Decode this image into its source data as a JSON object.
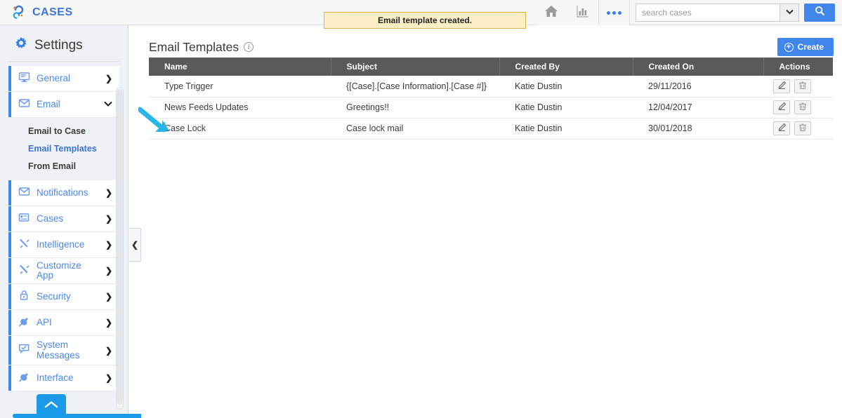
{
  "header": {
    "brand_name": "CASES",
    "brand_icon": "question-swirl-logo",
    "toast_message": "Email template created.",
    "home_icon": "home-icon",
    "reports_icon": "bar-chart-icon",
    "more_icon": "three-dots-icon",
    "search_placeholder": "search cases",
    "search_value": "",
    "search_caret_icon": "chevron-down-icon",
    "search_button_icon": "search-icon",
    "brand_color": "#3b74d6",
    "accent_color": "#4186ea",
    "toast_bg": "#fcefc7",
    "toast_border": "#d9b441"
  },
  "sidebar": {
    "title": "Settings",
    "title_icon": "gear-icon",
    "collapse_icon": "chevron-left-icon",
    "scroll_top_icon": "chevron-up-icon",
    "items": [
      {
        "label": "General",
        "icon": "monitor-icon",
        "chevron": "chevron-right-icon",
        "expanded": false
      },
      {
        "label": "Email",
        "icon": "envelope-icon",
        "chevron": "chevron-down-icon",
        "expanded": true
      },
      {
        "label": "Notifications",
        "icon": "envelope-icon",
        "chevron": "chevron-right-icon",
        "expanded": false
      },
      {
        "label": "Cases",
        "icon": "case-card-icon",
        "chevron": "chevron-right-icon",
        "expanded": false
      },
      {
        "label": "Intelligence",
        "icon": "tools-icon",
        "chevron": "chevron-right-icon",
        "expanded": false
      },
      {
        "label": "Customize App",
        "icon": "tools-icon",
        "chevron": "chevron-right-icon",
        "expanded": false
      },
      {
        "label": "Security",
        "icon": "lock-icon",
        "chevron": "chevron-right-icon",
        "expanded": false
      },
      {
        "label": "API",
        "icon": "plug-icon",
        "chevron": "chevron-right-icon",
        "expanded": false
      },
      {
        "label": "System Messages",
        "icon": "message-check-icon",
        "chevron": "chevron-right-icon",
        "expanded": false
      },
      {
        "label": "Interface",
        "icon": "plug-icon",
        "chevron": "chevron-right-icon",
        "expanded": false
      }
    ],
    "email_subitems": [
      {
        "label": "Email to Case",
        "active": false
      },
      {
        "label": "Email Templates",
        "active": true
      },
      {
        "label": "From Email",
        "active": false
      }
    ]
  },
  "main": {
    "page_title": "Email Templates",
    "info_icon": "info-icon",
    "create_label": "Create",
    "create_icon": "plus-circle-icon",
    "table": {
      "columns": [
        "Name",
        "Subject",
        "Created By",
        "Created On",
        "Actions"
      ],
      "rows": [
        {
          "name": "Type Trigger",
          "subject": "{[Case].[Case Information].[Case #]}",
          "created_by": "Katie Dustin",
          "created_on": "29/11/2016"
        },
        {
          "name": "News Feeds Updates",
          "subject": "Greetings!!",
          "created_by": "Katie Dustin",
          "created_on": "12/04/2017"
        },
        {
          "name": "Case Lock",
          "subject": "Case lock mail",
          "created_by": "Katie Dustin",
          "created_on": "30/01/2018"
        }
      ],
      "row_action_icons": [
        "edit-pencil-icon",
        "delete-trash-icon"
      ]
    }
  },
  "annotation": {
    "arrow_icon": "pointer-arrow-icon",
    "arrow_color": "#29b6e8"
  }
}
